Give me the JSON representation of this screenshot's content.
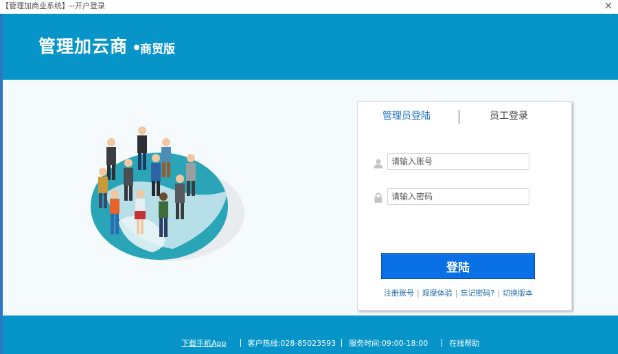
{
  "window": {
    "title": "【管理加商业系统】--开户登录",
    "close_glyph": "×"
  },
  "header": {
    "logo_main": "管理加云商",
    "logo_sub": "商贸版"
  },
  "login": {
    "tabs": [
      {
        "label": "管理员登陆",
        "active": true
      },
      {
        "label": "员工登录",
        "active": false
      }
    ],
    "account": {
      "placeholder": "请输入账号",
      "value": "",
      "icon": "user-icon"
    },
    "password": {
      "placeholder": "请输入密码",
      "value": "",
      "icon": "lock-icon"
    },
    "submit_label": "登陆",
    "links": [
      "注册账号",
      "观摩体验",
      "忘记密码?",
      "切换版本"
    ]
  },
  "footer": {
    "app_link": "下载手机App",
    "hotline": "客户热线:028-85023593",
    "hours": "服务时间:09:00-18:00",
    "help": "在线帮助"
  },
  "colors": {
    "brand": "#0795c9",
    "button": "#0a70e6",
    "active_tab": "#1a73c6"
  }
}
